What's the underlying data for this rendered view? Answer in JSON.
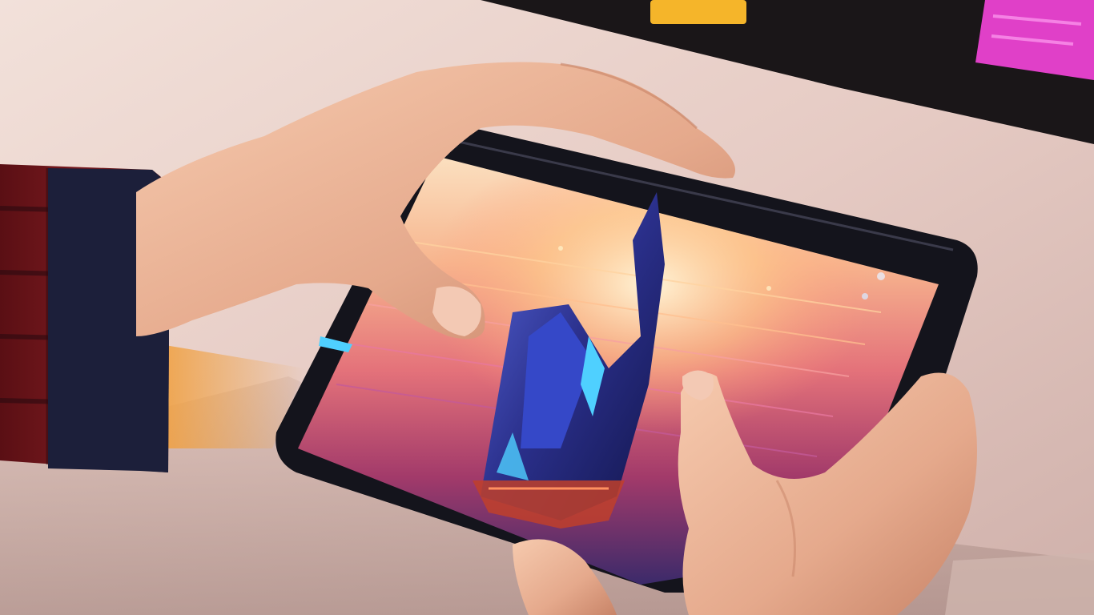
{
  "scene": {
    "subject": "hands-holding-tablet",
    "colors": {
      "desk": "#e8d2cc",
      "desk_shadow": "#b89a92",
      "sleeve_red": "#7a1a1f",
      "sleeve_navy": "#1c1f3a",
      "skin": "#e9b59c",
      "skin_shadow": "#c98a6e",
      "tablet_body": "#14141c",
      "screen_sky_top": "#f7c7a0",
      "screen_sky_mid": "#e07a7a",
      "screen_ground": "#8a2f5c",
      "ship_blue": "#2a3a9a",
      "ship_cyan": "#4fd0ff",
      "monitor_dark": "#1a1618",
      "accent_yellow": "#f5b52a",
      "accent_magenta": "#ff3fd0"
    }
  }
}
